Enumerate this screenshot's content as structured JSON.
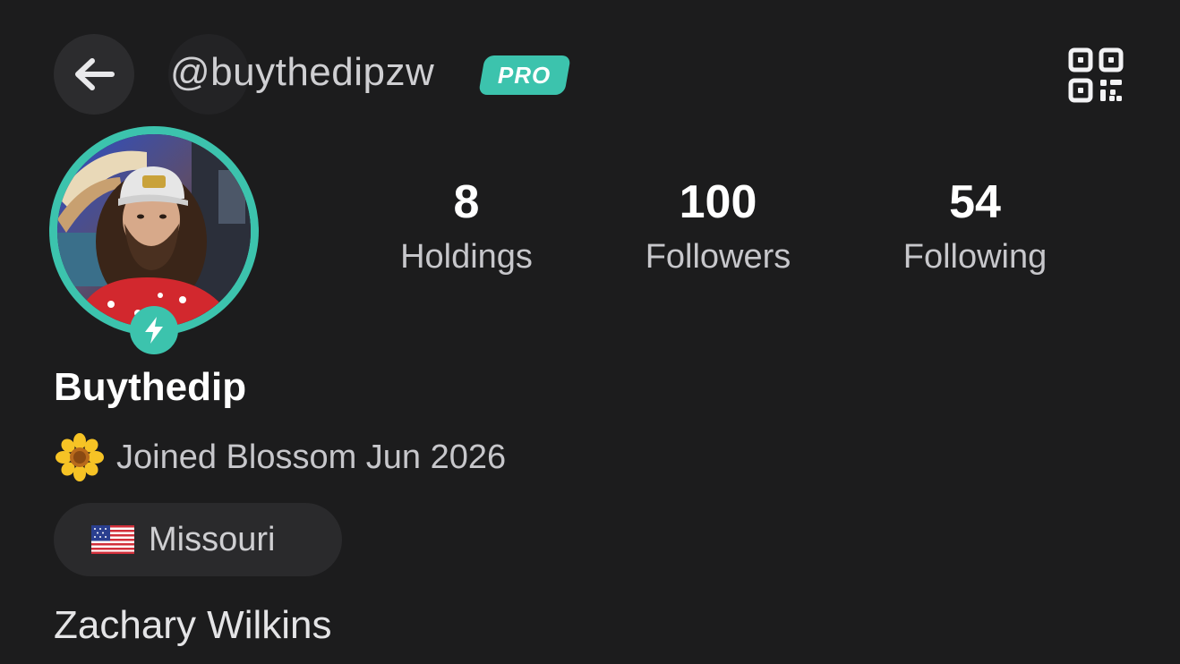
{
  "header": {
    "handle": "@buythedipzw",
    "badge": "PRO",
    "back_icon": "arrow-left-icon",
    "qr_icon": "qr-code-icon"
  },
  "profile": {
    "display_name": "Buythedip",
    "joined_text": "Joined Blossom Jun 2026",
    "joined_icon": "sunflower-icon",
    "location": "Missouri",
    "location_icon": "us-flag-icon",
    "real_name": "Zachary Wilkins",
    "avatar_badge_icon": "lightning-bolt-icon"
  },
  "stats": [
    {
      "value": "8",
      "label": "Holdings"
    },
    {
      "value": "100",
      "label": "Followers"
    },
    {
      "value": "54",
      "label": "Following"
    }
  ],
  "colors": {
    "background": "#1c1c1d",
    "accent": "#3cc3ad",
    "surface": "#2a2a2c",
    "secondary_text": "#c7c7cb"
  }
}
